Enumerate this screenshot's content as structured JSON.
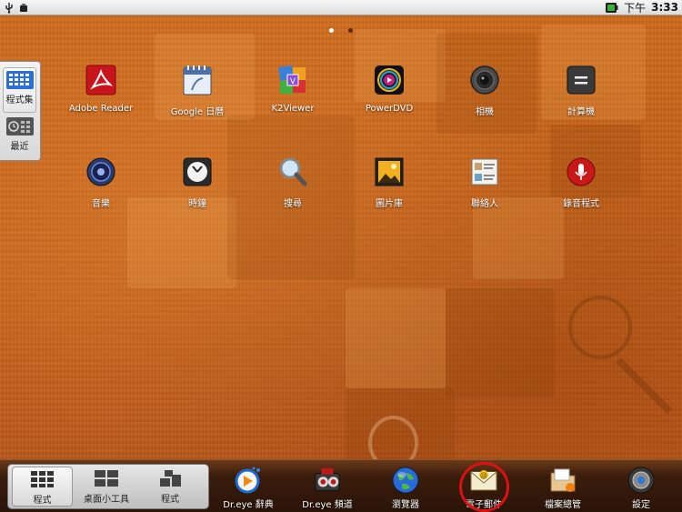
{
  "status_bar": {
    "ampm": "下午",
    "time": "3:33",
    "left_icons": [
      "usb-icon",
      "android-debug-icon"
    ],
    "right_icons": [
      "battery-icon"
    ]
  },
  "page_indicator": {
    "pages": 2,
    "current": 1
  },
  "side_nav": {
    "items": [
      {
        "label": "程式集",
        "icon": "grid-icon",
        "active": true
      },
      {
        "label": "最近",
        "icon": "recent-icon",
        "active": false
      }
    ]
  },
  "apps": [
    {
      "label": "Adobe Reader",
      "icon": "adobe-reader-icon"
    },
    {
      "label": "Google 日曆",
      "icon": "calendar-icon"
    },
    {
      "label": "K2Viewer",
      "icon": "k2viewer-icon"
    },
    {
      "label": "PowerDVD",
      "icon": "powerdvd-icon"
    },
    {
      "label": "相機",
      "icon": "camera-icon"
    },
    {
      "label": "計算機",
      "icon": "calculator-icon"
    },
    {
      "label": "音樂",
      "icon": "music-icon"
    },
    {
      "label": "時鐘",
      "icon": "clock-icon"
    },
    {
      "label": "搜尋",
      "icon": "search-icon"
    },
    {
      "label": "圖片庫",
      "icon": "gallery-icon"
    },
    {
      "label": "聯絡人",
      "icon": "contacts-icon"
    },
    {
      "label": "錄音程式",
      "icon": "recorder-icon"
    }
  ],
  "dock": {
    "tabs": [
      {
        "label": "程式",
        "icon": "apps-grid-icon",
        "active": true
      },
      {
        "label": "桌面小工具",
        "icon": "widgets-icon",
        "active": false
      },
      {
        "label": "程式",
        "icon": "shortcuts-icon",
        "active": false
      }
    ],
    "apps": [
      {
        "label": "Dr.eye 辭典",
        "icon": "dreye-dictionary-icon"
      },
      {
        "label": "Dr.eye 頻道",
        "icon": "dreye-channel-icon"
      },
      {
        "label": "瀏覽器",
        "icon": "browser-globe-icon"
      },
      {
        "label": "電子郵件",
        "icon": "email-icon",
        "highlighted": true
      },
      {
        "label": "檔案總管",
        "icon": "file-manager-icon"
      },
      {
        "label": "設定",
        "icon": "settings-icon"
      }
    ]
  },
  "colors": {
    "wallpaper": "#c8651b",
    "highlight": "#e01010",
    "dock": "#2a1408"
  }
}
